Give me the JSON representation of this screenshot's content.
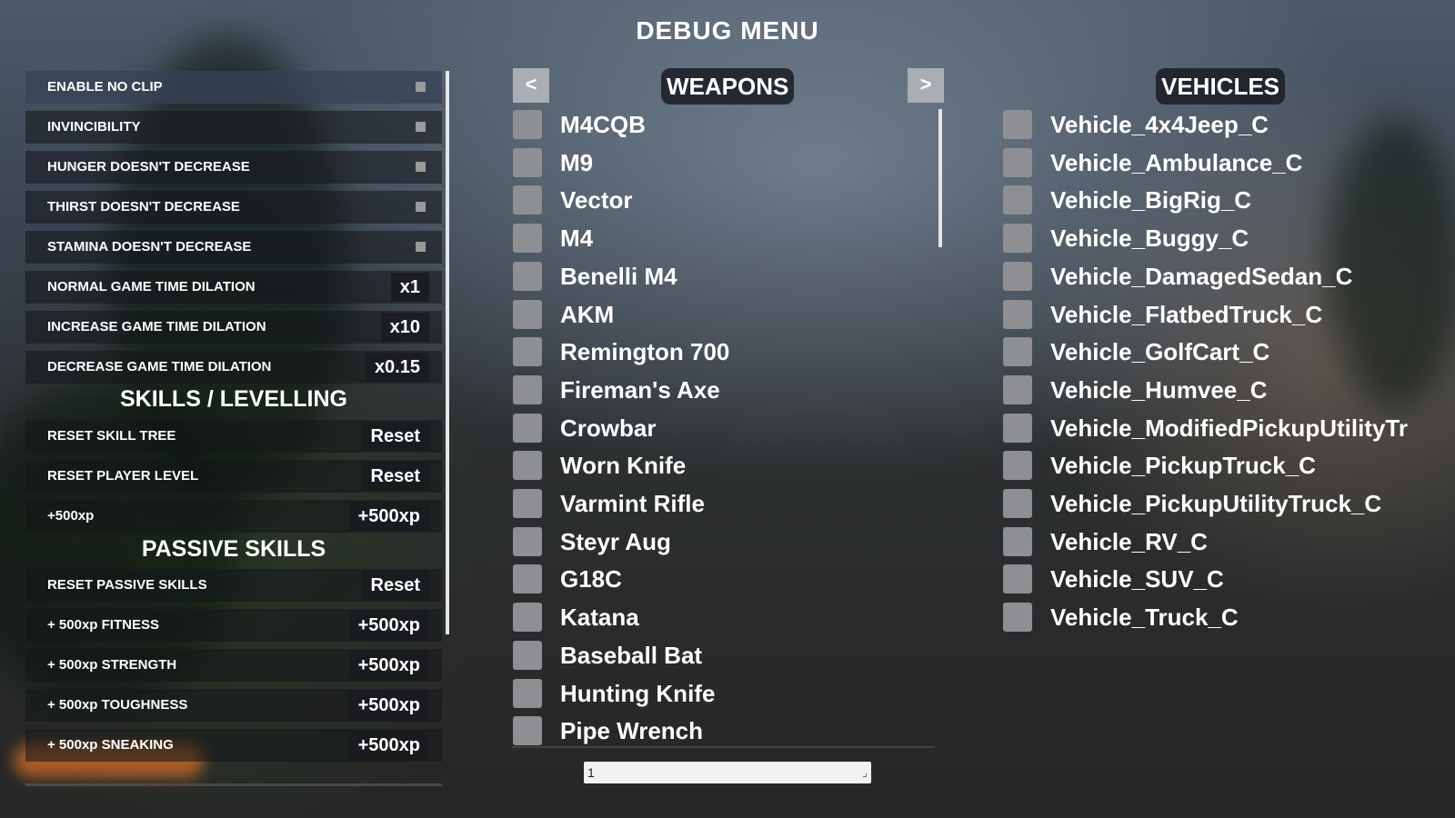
{
  "title": "DEBUG MENU",
  "left_panel": {
    "toggles": [
      {
        "label": "ENABLE NO CLIP",
        "active": true
      },
      {
        "label": "INVINCIBILITY",
        "active": false
      },
      {
        "label": "HUNGER DOESN'T DECREASE",
        "active": false
      },
      {
        "label": "THIRST DOESN'T DECREASE",
        "active": false
      },
      {
        "label": "STAMINA DOESN'T DECREASE",
        "active": false
      }
    ],
    "time_dilation": [
      {
        "label": "NORMAL GAME TIME DILATION",
        "button": "x1"
      },
      {
        "label": "INCREASE GAME TIME DILATION",
        "button": "x10"
      },
      {
        "label": "DECREASE GAME TIME DILATION",
        "button": "x0.15"
      }
    ],
    "skills_heading": "SKILLS / LEVELLING",
    "skills": [
      {
        "label": "RESET SKILL TREE",
        "button": "Reset"
      },
      {
        "label": "RESET PLAYER LEVEL",
        "button": "Reset"
      },
      {
        "label": "+500xp",
        "button": "+500xp"
      }
    ],
    "passive_heading": "PASSIVE SKILLS",
    "passive": [
      {
        "label": "RESET PASSIVE SKILLS",
        "button": "Reset"
      },
      {
        "label": "+ 500xp FITNESS",
        "button": "+500xp"
      },
      {
        "label": "+ 500xp STRENGTH",
        "button": "+500xp"
      },
      {
        "label": "+ 500xp TOUGHNESS",
        "button": "+500xp"
      },
      {
        "label": "+ 500xp SNEAKING",
        "button": "+500xp"
      }
    ]
  },
  "weapons": {
    "prev_label": "<",
    "next_label": ">",
    "heading": "WEAPONS",
    "items": [
      "M4CQB",
      "M9",
      "Vector",
      "M4",
      "Benelli M4",
      "AKM",
      "Remington 700",
      "Fireman's Axe",
      "Crowbar",
      "Worn Knife",
      "Varmint Rifle",
      "Steyr Aug",
      "G18C",
      "Katana",
      "Baseball Bat",
      "Hunting Knife",
      "Pipe Wrench"
    ],
    "page_value": "1"
  },
  "vehicles": {
    "heading": "VEHICLES",
    "items": [
      "Vehicle_4x4Jeep_C",
      "Vehicle_Ambulance_C",
      "Vehicle_BigRig_C",
      "Vehicle_Buggy_C",
      "Vehicle_DamagedSedan_C",
      "Vehicle_FlatbedTruck_C",
      "Vehicle_GolfCart_C",
      "Vehicle_Humvee_C",
      "Vehicle_ModifiedPickupUtilityTr",
      "Vehicle_PickupTruck_C",
      "Vehicle_PickupUtilityTruck_C",
      "Vehicle_RV_C",
      "Vehicle_SUV_C",
      "Vehicle_Truck_C"
    ]
  }
}
